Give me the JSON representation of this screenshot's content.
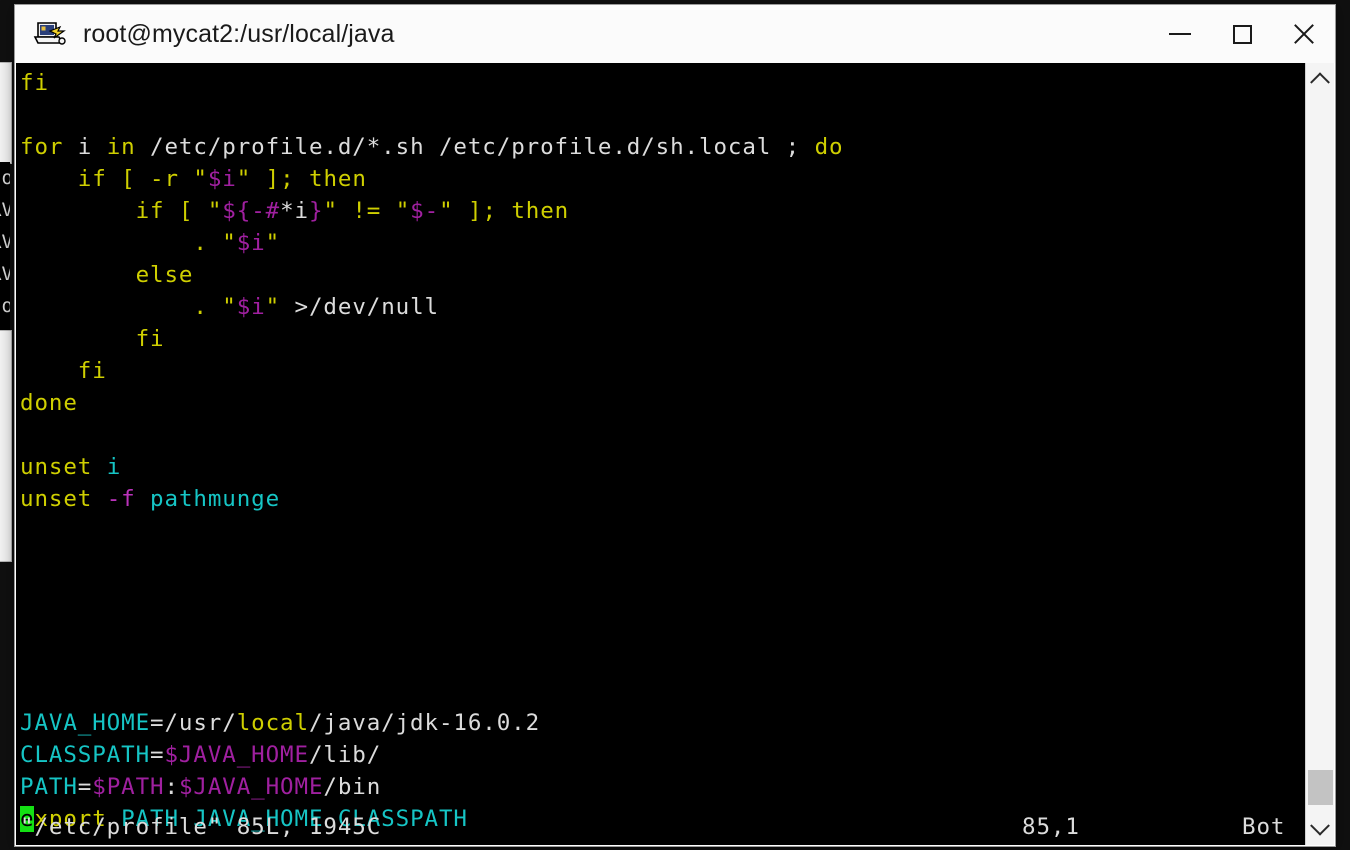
{
  "window": {
    "title": "root@mycat2:/usr/local/java",
    "icon": "putty-icon",
    "controls": {
      "minimize": "minimize-icon",
      "maximize": "maximize-icon",
      "close": "close-icon"
    }
  },
  "background_window": {
    "lines": [
      "to",
      "RV",
      "RV",
      "RV",
      "to"
    ]
  },
  "terminal": {
    "editor": "vim",
    "lines": [
      [
        {
          "t": "fi",
          "c": "kw"
        }
      ],
      [],
      [
        {
          "t": "for",
          "c": "kw"
        },
        {
          "t": " i ",
          "c": "txt"
        },
        {
          "t": "in",
          "c": "kw"
        },
        {
          "t": " /etc/profile.d/*.sh /etc/profile.d/sh.local ",
          "c": "txt"
        },
        {
          "t": ";",
          "c": "txt"
        },
        {
          "t": " do",
          "c": "kw"
        }
      ],
      [
        {
          "t": "    ",
          "c": "txt"
        },
        {
          "t": "if",
          "c": "kw"
        },
        {
          "t": " ",
          "c": "txt"
        },
        {
          "t": "[",
          "c": "kw"
        },
        {
          "t": " -r ",
          "c": "kw"
        },
        {
          "t": "\"",
          "c": "kw"
        },
        {
          "t": "$i",
          "c": "var"
        },
        {
          "t": "\"",
          "c": "kw"
        },
        {
          "t": " ",
          "c": "txt"
        },
        {
          "t": "]",
          "c": "kw"
        },
        {
          "t": ";",
          "c": "kw"
        },
        {
          "t": " then",
          "c": "kw"
        }
      ],
      [
        {
          "t": "        ",
          "c": "txt"
        },
        {
          "t": "if",
          "c": "kw"
        },
        {
          "t": " ",
          "c": "txt"
        },
        {
          "t": "[",
          "c": "kw"
        },
        {
          "t": " ",
          "c": "txt"
        },
        {
          "t": "\"",
          "c": "kw"
        },
        {
          "t": "${-#",
          "c": "var"
        },
        {
          "t": "*",
          "c": "txt"
        },
        {
          "t": "i",
          "c": "txt"
        },
        {
          "t": "}",
          "c": "var"
        },
        {
          "t": "\"",
          "c": "kw"
        },
        {
          "t": " ",
          "c": "txt"
        },
        {
          "t": "!=",
          "c": "kw"
        },
        {
          "t": " ",
          "c": "txt"
        },
        {
          "t": "\"",
          "c": "kw"
        },
        {
          "t": "$-",
          "c": "var"
        },
        {
          "t": "\"",
          "c": "kw"
        },
        {
          "t": " ",
          "c": "txt"
        },
        {
          "t": "]",
          "c": "kw"
        },
        {
          "t": ";",
          "c": "kw"
        },
        {
          "t": " then",
          "c": "kw"
        }
      ],
      [
        {
          "t": "            ",
          "c": "txt"
        },
        {
          "t": ".",
          "c": "kw"
        },
        {
          "t": " ",
          "c": "txt"
        },
        {
          "t": "\"",
          "c": "kw"
        },
        {
          "t": "$i",
          "c": "var"
        },
        {
          "t": "\"",
          "c": "kw"
        }
      ],
      [
        {
          "t": "        ",
          "c": "txt"
        },
        {
          "t": "else",
          "c": "kw"
        }
      ],
      [
        {
          "t": "            ",
          "c": "txt"
        },
        {
          "t": ".",
          "c": "kw"
        },
        {
          "t": " ",
          "c": "txt"
        },
        {
          "t": "\"",
          "c": "kw"
        },
        {
          "t": "$i",
          "c": "var"
        },
        {
          "t": "\"",
          "c": "kw"
        },
        {
          "t": " ",
          "c": "txt"
        },
        {
          "t": ">/dev/null",
          "c": "txt"
        }
      ],
      [
        {
          "t": "        ",
          "c": "txt"
        },
        {
          "t": "fi",
          "c": "kw"
        }
      ],
      [
        {
          "t": "    ",
          "c": "txt"
        },
        {
          "t": "fi",
          "c": "kw"
        }
      ],
      [
        {
          "t": "done",
          "c": "kw"
        }
      ],
      [],
      [
        {
          "t": "unset",
          "c": "kw"
        },
        {
          "t": " ",
          "c": "txt"
        },
        {
          "t": "i",
          "c": "cy"
        }
      ],
      [
        {
          "t": "unset",
          "c": "kw"
        },
        {
          "t": " ",
          "c": "txt"
        },
        {
          "t": "-f",
          "c": "mg"
        },
        {
          "t": " ",
          "c": "txt"
        },
        {
          "t": "pathmunge",
          "c": "cy"
        }
      ],
      [],
      [],
      [],
      [],
      [],
      [],
      [
        {
          "t": "JAVA_HOME",
          "c": "cy"
        },
        {
          "t": "=/usr/",
          "c": "txt"
        },
        {
          "t": "local",
          "c": "yl"
        },
        {
          "t": "/java/jdk-16.0.2",
          "c": "txt"
        }
      ],
      [
        {
          "t": "CLASSPATH",
          "c": "cy"
        },
        {
          "t": "=",
          "c": "txt"
        },
        {
          "t": "$JAVA_HOME",
          "c": "var"
        },
        {
          "t": "/lib/",
          "c": "txt"
        }
      ],
      [
        {
          "t": "PATH",
          "c": "cy"
        },
        {
          "t": "=",
          "c": "txt"
        },
        {
          "t": "$PATH",
          "c": "var"
        },
        {
          "t": ":",
          "c": "txt"
        },
        {
          "t": "$JAVA_HOME",
          "c": "var"
        },
        {
          "t": "/bin",
          "c": "txt"
        }
      ],
      [
        {
          "t": "e",
          "c": "cursor"
        },
        {
          "t": "xport",
          "c": "kw"
        },
        {
          "t": " ",
          "c": "txt"
        },
        {
          "t": "PATH JAVA_HOME CLASSPATH",
          "c": "cy"
        }
      ]
    ],
    "status": {
      "file": "\"/etc/profile\" 85L, 1945C",
      "position": "85,1",
      "mode": "Bot"
    }
  },
  "scrollbar": {
    "up_arrow": "chevron-up-icon",
    "down_arrow": "chevron-down-icon",
    "thumb": "scrollbar-thumb"
  },
  "colors": {
    "terminal_bg": "#000000",
    "keyword": "#cfcf00",
    "text": "#dcdcdc",
    "variable": "#a020a0",
    "identifier": "#16c5c5",
    "cursor": "#14e014",
    "titlebar_bg": "#fbfbfb"
  }
}
